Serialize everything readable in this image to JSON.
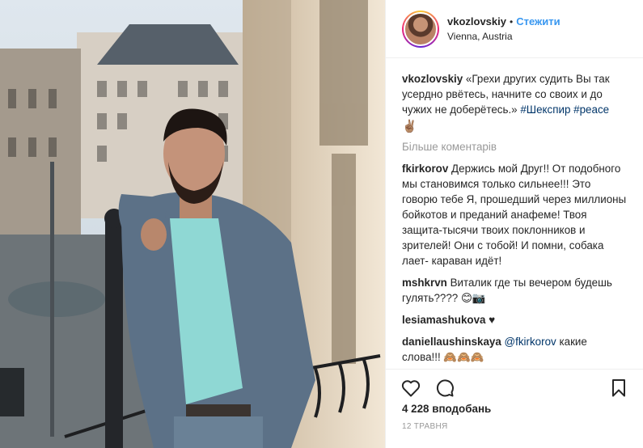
{
  "post": {
    "username": "vkozlovskiy",
    "follow_label": "Стежити",
    "separator": "•",
    "location": "Vienna, Austria",
    "photo_alt": "photo"
  },
  "caption": {
    "user": "vkozlovskiy",
    "text": "«Грехи других судить Вы так усердно рвётесь, начните со своих и до чужих не доберётесь.» ",
    "tags": [
      "#Шекспир",
      "#peace"
    ],
    "emoji": "✌🏽"
  },
  "more_comments_label": "Більше коментарів",
  "comments": [
    {
      "user": "fkirkorov",
      "text": "Держись мой Друг!! От подобного мы становимся только сильнее!!! Это говорю тебе Я, прошедший через миллионы бойкотов и преданий анафеме! Твоя защита-тысячи твоих поклонников и зрителей! Они с тобой! И помни, собака лает- караван идёт!"
    },
    {
      "user": "mshkrvn",
      "text": "Виталик где ты вечером будешь гулять???? 😊📷"
    },
    {
      "user": "lesiamashukova",
      "text": "♥"
    },
    {
      "user": "daniellaushinskaya",
      "mention": "@fkirkorov",
      "text": "какие слова!!! 🙈🙈🙈"
    }
  ],
  "icons": {
    "like": "heart-icon",
    "comment": "comment-icon",
    "save": "bookmark-icon"
  },
  "likes_label": "4 228 вподобань",
  "date_label": "12 травня"
}
